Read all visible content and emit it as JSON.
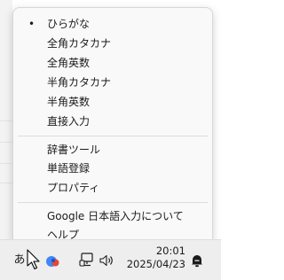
{
  "menu": {
    "selected_marker": "•",
    "group1": [
      {
        "label": "ひらがな",
        "checked": true
      },
      {
        "label": "全角カタカナ",
        "checked": false
      },
      {
        "label": "全角英数",
        "checked": false
      },
      {
        "label": "半角カタカナ",
        "checked": false
      },
      {
        "label": "半角英数",
        "checked": false
      },
      {
        "label": "直接入力",
        "checked": false
      }
    ],
    "group2": [
      {
        "label": "辞書ツール"
      },
      {
        "label": "単語登録"
      },
      {
        "label": "プロパティ"
      }
    ],
    "group3": [
      {
        "label": "Google 日本語入力について"
      },
      {
        "label": "ヘルプ"
      }
    ]
  },
  "taskbar": {
    "ime_mode": "あ",
    "time": "20:01",
    "date": "2025/04/23",
    "icons": {
      "cursor": "mouse-cursor-icon",
      "google_ime": "google-ime-icon",
      "network": "network-icon",
      "volume": "volume-icon",
      "notifications": "notification-bell-icon"
    },
    "colors": {
      "google_blue": "#4285f4",
      "google_red": "#ea4335"
    }
  }
}
